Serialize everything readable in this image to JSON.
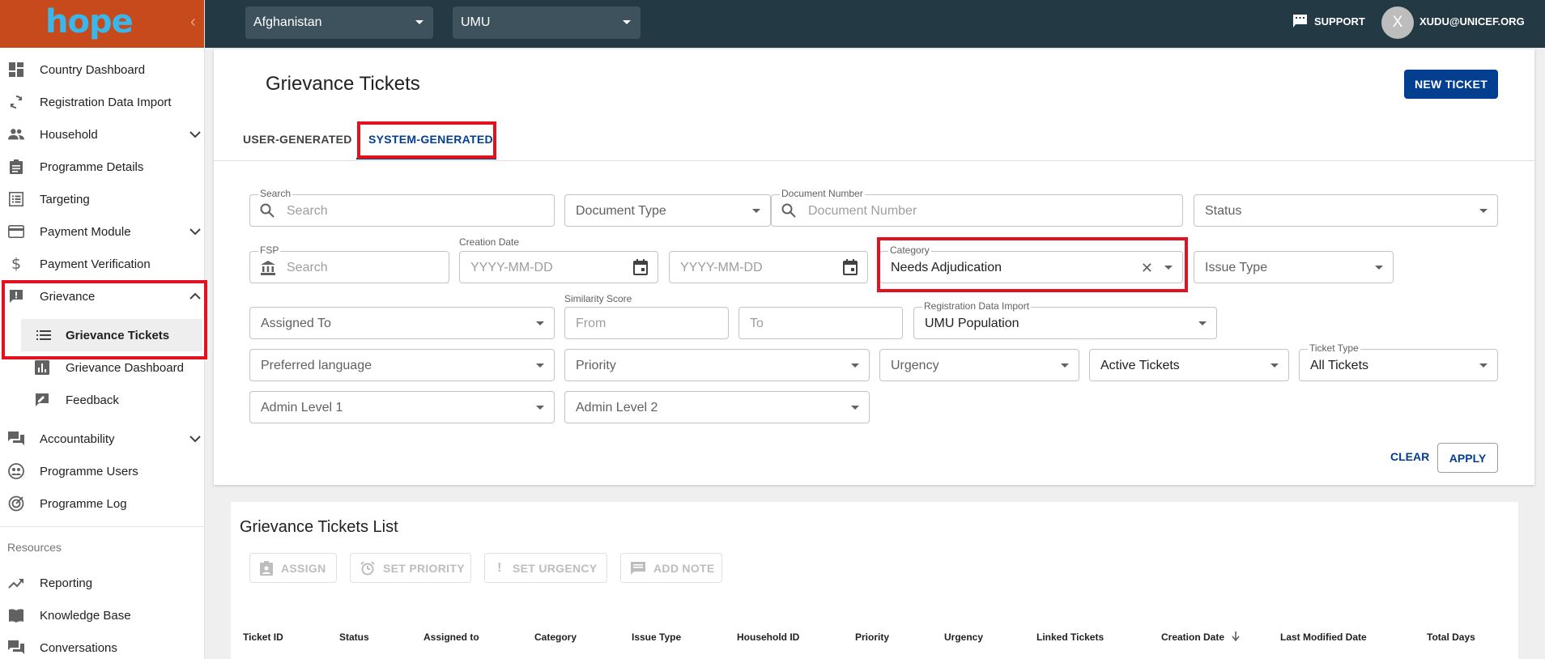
{
  "app": {
    "logo": "hope"
  },
  "topbar": {
    "country": "Afghanistan",
    "program": "UMU",
    "support": "SUPPORT",
    "avatar_letter": "X",
    "email": "XUDU@UNICEF.ORG"
  },
  "sidebar": {
    "items": [
      {
        "label": "Country Dashboard",
        "icon": "dashboard-icon"
      },
      {
        "label": "Registration Data Import",
        "icon": "refresh-icon"
      },
      {
        "label": "Household",
        "icon": "people-icon"
      },
      {
        "label": "Programme Details",
        "icon": "clipboard-icon"
      },
      {
        "label": "Targeting",
        "icon": "list-icon"
      },
      {
        "label": "Payment Module",
        "icon": "credit-card-icon"
      },
      {
        "label": "Payment Verification",
        "icon": "dollar-icon"
      },
      {
        "label": "Grievance",
        "icon": "feedback-icon"
      },
      {
        "label": "Grievance Tickets",
        "icon": "list-icon"
      },
      {
        "label": "Grievance Dashboard",
        "icon": "chart-icon"
      },
      {
        "label": "Feedback",
        "icon": "rate-review-icon"
      },
      {
        "label": "Accountability",
        "icon": "forum-icon"
      },
      {
        "label": "Programme Users",
        "icon": "users-icon"
      },
      {
        "label": "Programme Log",
        "icon": "track-changes-icon"
      }
    ],
    "resources_label": "Resources",
    "resources": [
      {
        "label": "Reporting",
        "icon": "trending-up-icon"
      },
      {
        "label": "Knowledge Base",
        "icon": "book-icon"
      },
      {
        "label": "Conversations",
        "icon": "forum-icon"
      }
    ]
  },
  "page": {
    "title": "Grievance Tickets",
    "new_ticket": "NEW TICKET",
    "tabs": [
      "USER-GENERATED",
      "SYSTEM-GENERATED"
    ]
  },
  "filters": {
    "search_label": "Search",
    "search_ph": "Search",
    "document_type": "Document Type",
    "doc_number_label": "Document Number",
    "doc_number_ph": "Document Number",
    "status": "Status",
    "fsp_label": "FSP",
    "fsp_ph": "Search",
    "creation_date_label": "Creation Date",
    "date_from_ph": "YYYY-MM-DD",
    "date_to_ph": "YYYY-MM-DD",
    "category_label": "Category",
    "category_value": "Needs Adjudication",
    "issue_type": "Issue Type",
    "assigned_to": "Assigned To",
    "similarity_label": "Similarity Score",
    "sim_from": "From",
    "sim_to": "To",
    "rdi_label": "Registration Data Import",
    "rdi_value": "UMU Population",
    "preferred_language": "Preferred language",
    "priority": "Priority",
    "urgency": "Urgency",
    "active_tickets": "Active Tickets",
    "ticket_type_label": "Ticket Type",
    "ticket_type_value": "All Tickets",
    "admin1": "Admin Level 1",
    "admin2": "Admin Level 2",
    "clear": "CLEAR",
    "apply": "APPLY"
  },
  "list": {
    "title": "Grievance Tickets List",
    "actions": [
      "ASSIGN",
      "SET PRIORITY",
      "SET URGENCY",
      "ADD NOTE"
    ],
    "columns": [
      "Ticket ID",
      "Status",
      "Assigned to",
      "Category",
      "Issue Type",
      "Household ID",
      "Priority",
      "Urgency",
      "Linked Tickets",
      "Creation Date",
      "Last Modified Date",
      "Total Days"
    ]
  },
  "colors": {
    "brand_orange": "#c74a1c",
    "topbar": "#233944",
    "primary": "#033f91",
    "highlight": "#e0131f"
  }
}
